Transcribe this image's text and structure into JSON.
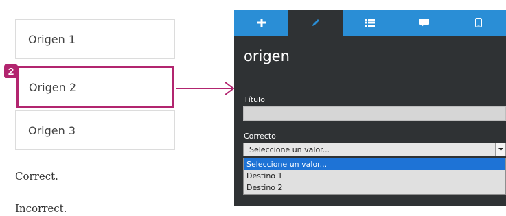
{
  "origins": [
    {
      "label": "Origen 1"
    },
    {
      "label": "Origen 2"
    },
    {
      "label": "Origen 3"
    }
  ],
  "step_badge": "2",
  "feedback": {
    "correct": "Correct.",
    "incorrect": "Incorrect."
  },
  "panel": {
    "tabs": [
      {
        "icon": "plus-icon"
      },
      {
        "icon": "pencil-icon",
        "active": true
      },
      {
        "icon": "list-icon"
      },
      {
        "icon": "comment-icon"
      },
      {
        "icon": "mobile-icon"
      }
    ],
    "title": "origen",
    "titulo_label": "Título",
    "titulo_value": "",
    "correcto_label": "Correcto",
    "select_value": "Seleccione un valor...",
    "options": [
      "Seleccione un valor...",
      "Destino 1",
      "Destino 2"
    ]
  },
  "colors": {
    "accent": "#b2256f",
    "tabbar": "#2a8ed6",
    "panel_bg": "#2f3234",
    "option_highlight": "#1e73d6"
  }
}
